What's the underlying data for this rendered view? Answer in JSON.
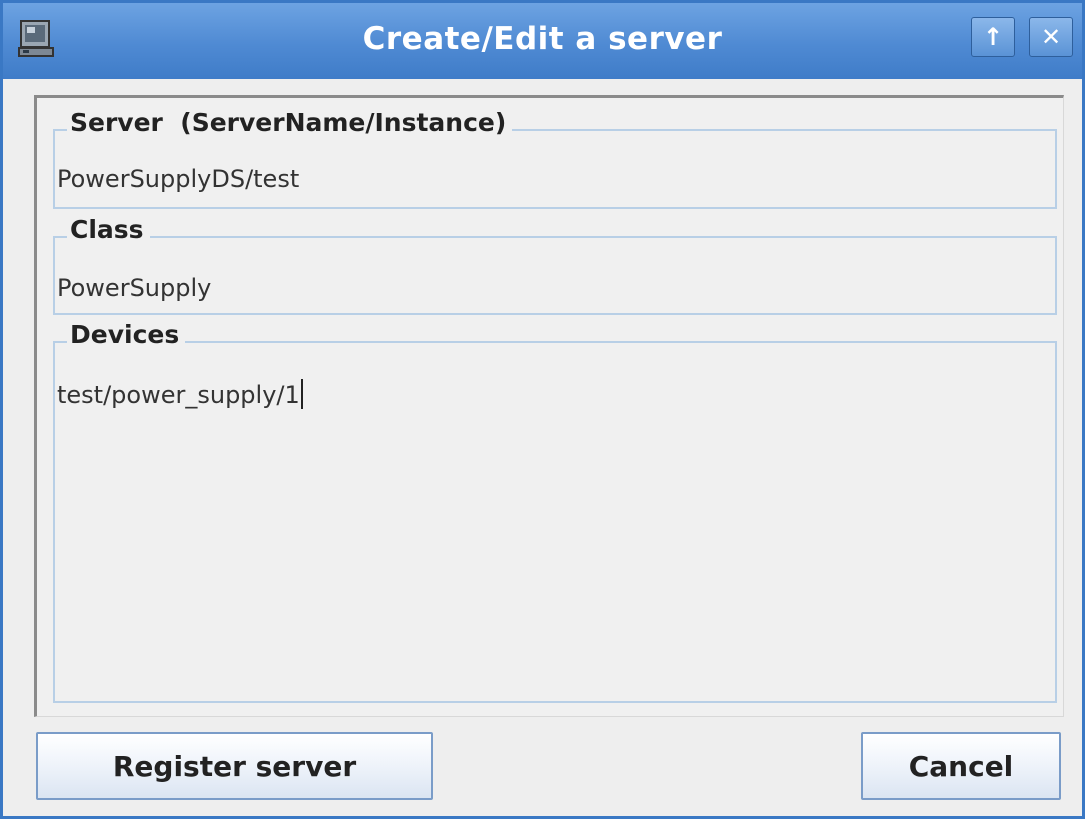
{
  "window": {
    "title": "Create/Edit a server",
    "app_icon": "computer-icon",
    "controls": {
      "up_label": "↑",
      "close_label": "✕"
    }
  },
  "form": {
    "server": {
      "legend": "Server  (ServerName/Instance)",
      "value": "PowerSupplyDS/test"
    },
    "class": {
      "legend": "Class",
      "value": "PowerSupply"
    },
    "devices": {
      "legend": "Devices",
      "value": "test/power_supply/1"
    }
  },
  "buttons": {
    "register_label": "Register server",
    "cancel_label": "Cancel"
  },
  "colors": {
    "titlebar": "#4f8ad3",
    "group_border": "#b8cfe6",
    "button_border": "#7a9cc8"
  }
}
